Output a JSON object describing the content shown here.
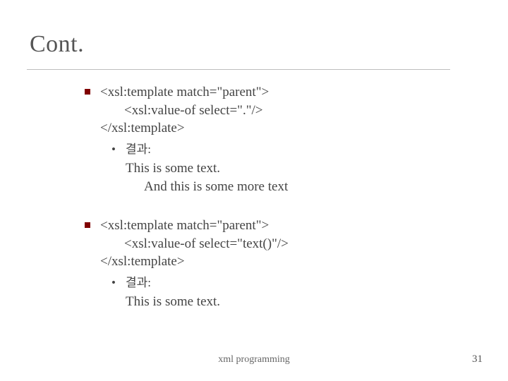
{
  "title": "Cont.",
  "blocks": [
    {
      "code": {
        "l1": "<xsl:template match=\"parent\">",
        "l2": "<xsl:value-of select=\".\"/>",
        "l3": "</xsl:template>"
      },
      "result_label": "결과:",
      "result_lines": {
        "r1": "This is some text.",
        "r2": "And this is some more text"
      }
    },
    {
      "code": {
        "l1": "<xsl:template match=\"parent\">",
        "l2": "<xsl:value-of select=\"text()\"/>",
        "l3": "</xsl:template>"
      },
      "result_label": "결과:",
      "result_lines": {
        "r1": "This is some text."
      }
    }
  ],
  "footer": {
    "center": "xml programming",
    "page": "31"
  }
}
